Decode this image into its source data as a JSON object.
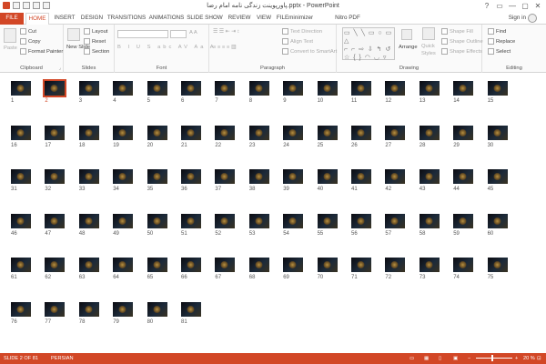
{
  "title": {
    "text": "پاورپوینت زندگی نامه امام رضا.pptx - PowerPoint"
  },
  "titlebar_icons": [
    "powerpoint-icon",
    "save-icon",
    "undo-icon",
    "redo-icon",
    "slideshow-icon",
    "customize-icon"
  ],
  "window_controls": [
    "?",
    "▭",
    "—",
    "▢",
    "✕"
  ],
  "tabs": [
    "FILE",
    "HOME",
    "INSERT",
    "DESIGN",
    "TRANSITIONS",
    "ANIMATIONS",
    "SLIDE SHOW",
    "REVIEW",
    "VIEW",
    "FILEminimizer",
    "Nitro PDF Professional"
  ],
  "signin": "Sign in",
  "ribbon": {
    "clipboard": {
      "label": "Clipboard",
      "paste": "Paste",
      "cut": "Cut",
      "copy": "Copy",
      "format_painter": "Format Painter"
    },
    "slides": {
      "label": "Slides",
      "new_slide": "New Slide",
      "layout": "Layout",
      "reset": "Reset",
      "section": "Section"
    },
    "font": {
      "label": "Font",
      "buttons": [
        "B",
        "I",
        "U",
        "S",
        "abc",
        "AV",
        "Aa",
        "A"
      ]
    },
    "paragraph": {
      "label": "Paragraph",
      "text_direction": "Text Direction",
      "align_text": "Align Text",
      "convert": "Convert to SmartArt"
    },
    "drawing": {
      "label": "Drawing",
      "arrange": "Arrange",
      "quick_styles": "Quick Styles",
      "shape_fill": "Shape Fill",
      "shape_outline": "Shape Outline",
      "shape_effects": "Shape Effects"
    },
    "editing": {
      "label": "Editing",
      "find": "Find",
      "replace": "Replace",
      "select": "Select"
    }
  },
  "slides": {
    "total": 81,
    "selected": 2,
    "per_row": 15
  },
  "status": {
    "slide_info": "SLIDE 2 OF 81",
    "language": "PERSIAN",
    "zoom": "20 %"
  }
}
